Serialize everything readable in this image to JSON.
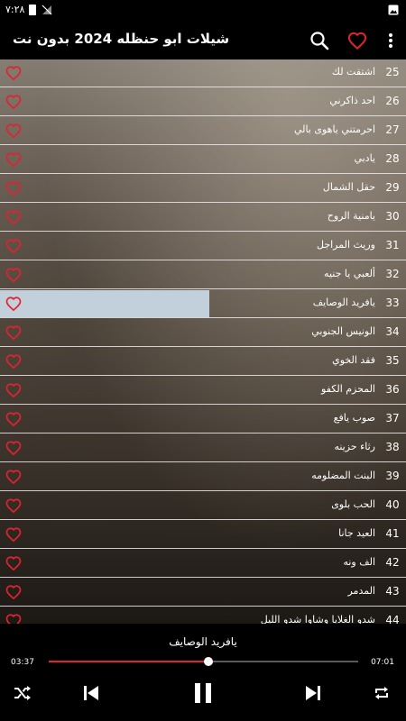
{
  "status_bar": {
    "time": "٧:٢٨",
    "icons": [
      "battery-icon",
      "no-signal-icon",
      "gallery-icon"
    ]
  },
  "app_bar": {
    "title": "شيلات ابو حنظله 2024 بدون نت",
    "icons": [
      "search-icon",
      "heart-icon",
      "more-vert-icon"
    ]
  },
  "colors": {
    "accent": "#e0232e",
    "selected_row": "#c2d0dc",
    "background": "#000000"
  },
  "playlist": [
    {
      "num": "25",
      "title": "اشتقت لك"
    },
    {
      "num": "26",
      "title": "احد ذاكرني"
    },
    {
      "num": "27",
      "title": "احرمتني ياهوى بالي"
    },
    {
      "num": "28",
      "title": "يادبي"
    },
    {
      "num": "29",
      "title": "حقل الشمال"
    },
    {
      "num": "30",
      "title": "يامنية الروح"
    },
    {
      "num": "31",
      "title": "وريث المراجل"
    },
    {
      "num": "32",
      "title": "ألعبي يا جنيه"
    },
    {
      "num": "33",
      "title": "يافريد الوصايف",
      "selected": true
    },
    {
      "num": "34",
      "title": "الونيس الجنوبي"
    },
    {
      "num": "35",
      "title": "فقد الخوي"
    },
    {
      "num": "36",
      "title": "المحزم الكفو"
    },
    {
      "num": "37",
      "title": "صوب يافع"
    },
    {
      "num": "38",
      "title": "رثاء حزينه"
    },
    {
      "num": "39",
      "title": "البنت المضلومه"
    },
    {
      "num": "40",
      "title": "الحب بلوى"
    },
    {
      "num": "41",
      "title": "العيد جانا"
    },
    {
      "num": "42",
      "title": "الف ونه"
    },
    {
      "num": "43",
      "title": "المدمر"
    },
    {
      "num": "44",
      "title": "شدو الغلايا وشاوا شدو الليل"
    }
  ],
  "player": {
    "now_playing": "يافريد الوصايف",
    "current_time": "03:37",
    "total_time": "07:01",
    "progress": 0.516,
    "controls": [
      "shuffle-icon",
      "previous-icon",
      "pause-icon",
      "next-icon",
      "repeat-icon"
    ]
  }
}
